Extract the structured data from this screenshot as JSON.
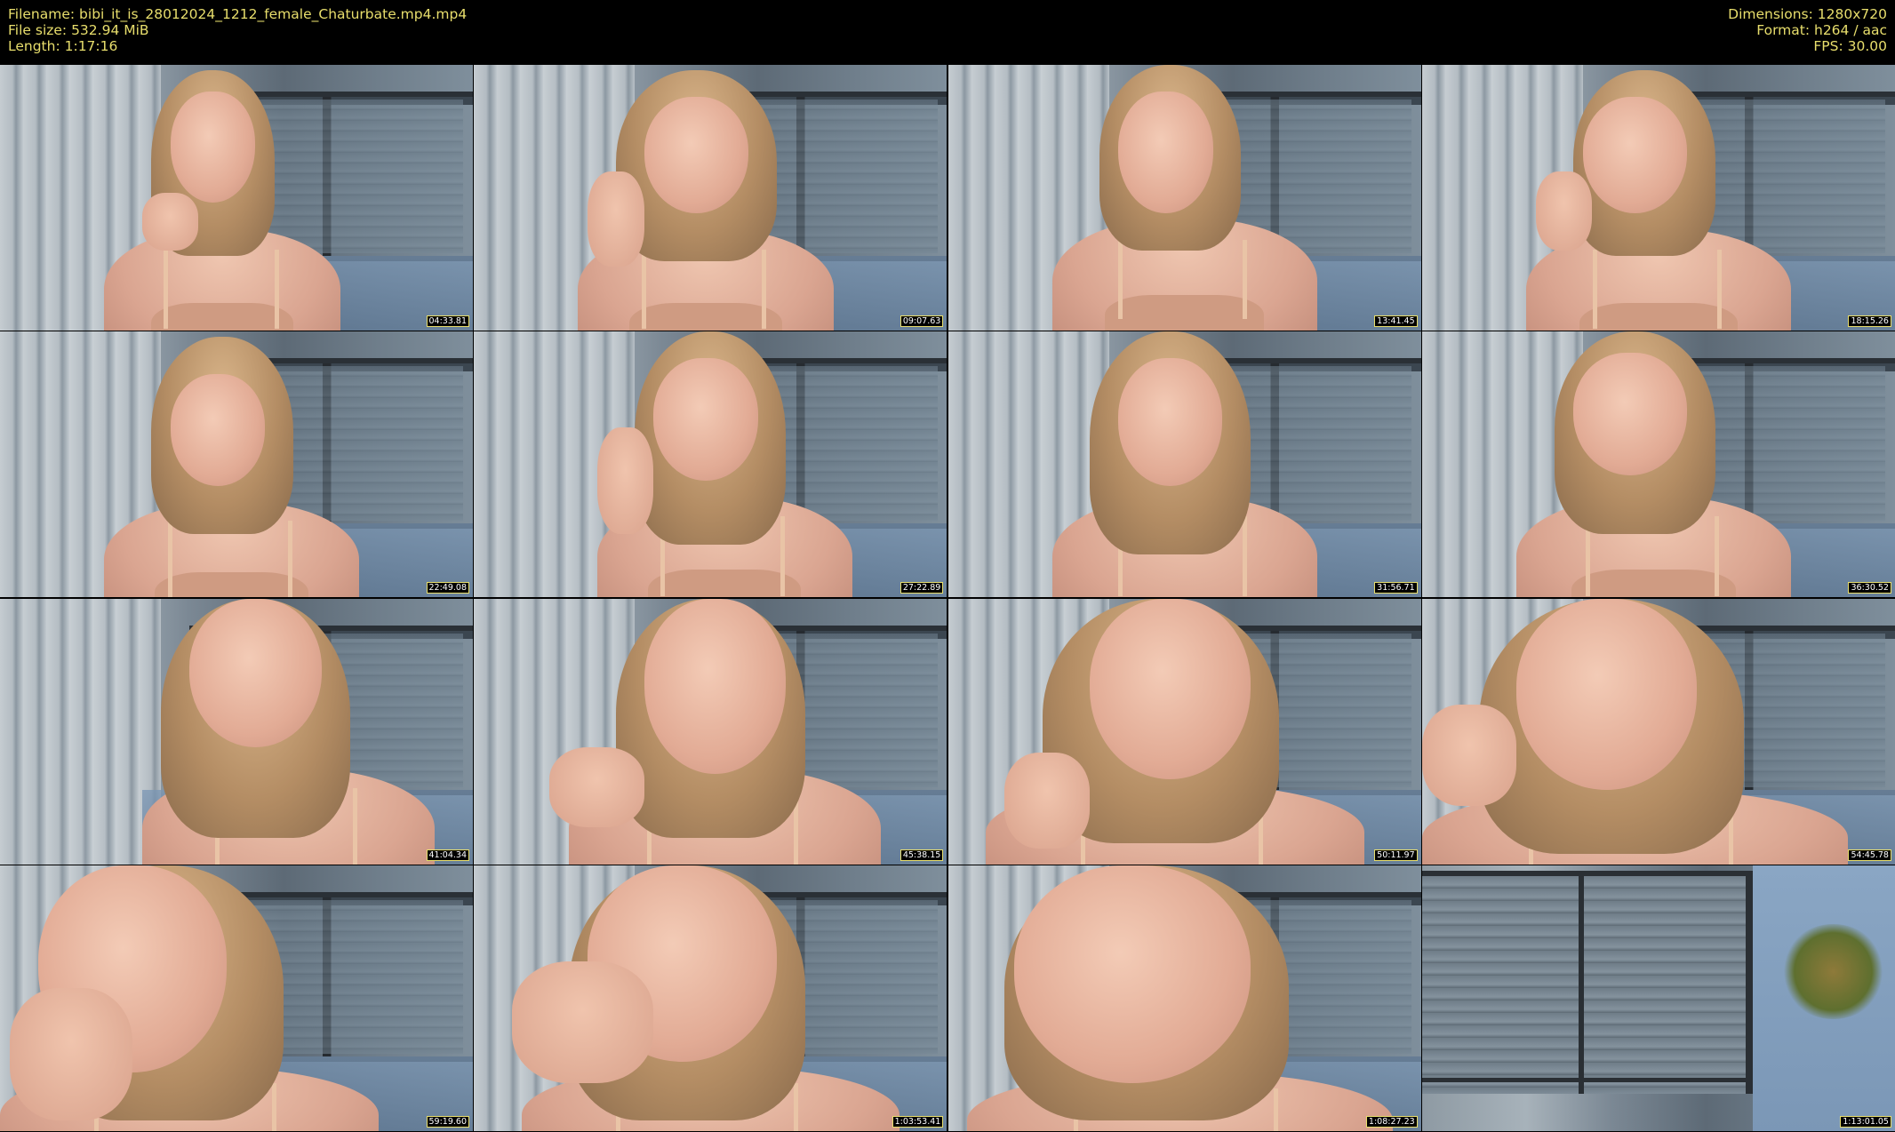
{
  "header": {
    "filename": "Filename: bibi_it_is_28012024_1212_female_Chaturbate.mp4.mp4",
    "filesize": "File size: 532.94 MiB",
    "length": "Length: 1:17:16",
    "dimensions": "Dimensions: 1280x720",
    "format": "Format: h264 / aac",
    "fps": "FPS: 30.00"
  },
  "colors": {
    "header_text": "#e8de6c",
    "background": "#000000"
  },
  "thumbnails": [
    {
      "timestamp": "04:33.81"
    },
    {
      "timestamp": "09:07.63"
    },
    {
      "timestamp": "13:41.45"
    },
    {
      "timestamp": "18:15.26"
    },
    {
      "timestamp": "22:49.08"
    },
    {
      "timestamp": "27:22.89"
    },
    {
      "timestamp": "31:56.71"
    },
    {
      "timestamp": "36:30.52"
    },
    {
      "timestamp": "41:04.34"
    },
    {
      "timestamp": "45:38.15"
    },
    {
      "timestamp": "50:11.97"
    },
    {
      "timestamp": "54:45.78"
    },
    {
      "timestamp": "59:19.60"
    },
    {
      "timestamp": "1:03:53.41"
    },
    {
      "timestamp": "1:08:27.23"
    },
    {
      "timestamp": "1:13:01.05"
    }
  ]
}
